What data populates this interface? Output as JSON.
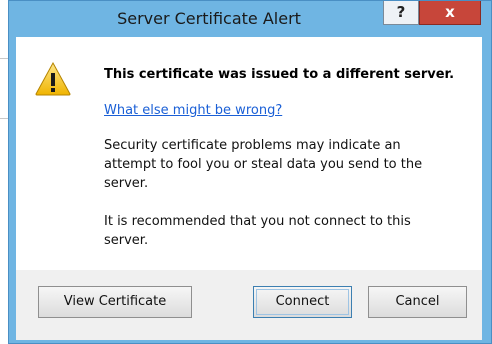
{
  "window": {
    "title": "Server Certificate Alert",
    "help_label": "?",
    "close_label": "x"
  },
  "content": {
    "headline": "This certificate was issued to a different server.",
    "link": "What else might be wrong?",
    "paragraph1": "Security certificate problems may indicate an attempt to fool you or steal data you send to the server.",
    "paragraph2": "It is recommended that you not connect to this server."
  },
  "buttons": {
    "view_certificate": "View Certificate",
    "connect": "Connect",
    "cancel": "Cancel"
  },
  "icons": {
    "warning": "warning-icon"
  },
  "colors": {
    "window_frame": "#6fb5e3",
    "close_button": "#c7463a",
    "link": "#1a5fd6",
    "warning": "#f5c518"
  }
}
